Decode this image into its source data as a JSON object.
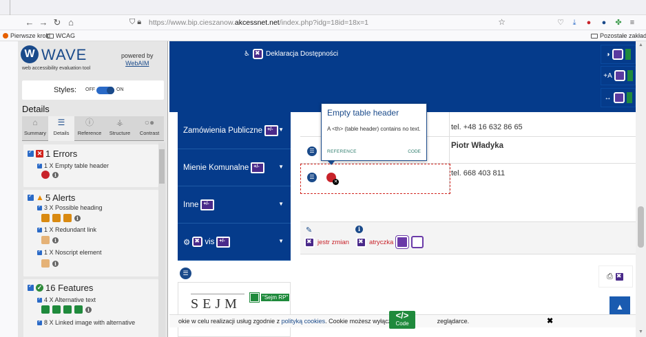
{
  "browser": {
    "url_prefix": "https://www.bip.cieszanow.",
    "url_domain": "akcessnet.net",
    "url_suffix": "/index.php?idg=18id=18x=1",
    "bookmarks": [
      "Pierwsze kroki",
      "WCAG"
    ],
    "other_bookmarks": "Pozostałe zakładki"
  },
  "wave": {
    "logo_letter": "W",
    "logo_text": "WAVE",
    "tagline": "web accessibility evaluation tool",
    "powered_by": "powered by",
    "webaim": "WebAIM",
    "styles_label": "Styles:",
    "off": "OFF",
    "on": "ON",
    "details_title": "Details",
    "tabs": [
      {
        "label": "Summary",
        "icon": "home-icon"
      },
      {
        "label": "Details",
        "icon": "list-icon"
      },
      {
        "label": "Reference",
        "icon": "info-icon"
      },
      {
        "label": "Structure",
        "icon": "structure-icon"
      },
      {
        "label": "Contrast",
        "icon": "contrast-icon"
      }
    ],
    "errors": {
      "title": "1 Errors",
      "items": [
        {
          "label": "1 X Empty table header"
        }
      ]
    },
    "alerts": {
      "title": "5 Alerts",
      "items": [
        {
          "label": "3 X Possible heading"
        },
        {
          "label": "1 X Redundant link"
        },
        {
          "label": "1 X Noscript element"
        }
      ]
    },
    "features": {
      "title": "16 Features",
      "items": [
        {
          "label": "4 X Alternative text"
        },
        {
          "label": "8 X Linked image with alternative"
        }
      ]
    }
  },
  "page": {
    "declaration": "Deklaracja Dostępności",
    "menu": [
      {
        "label": "Zamówienia Publiczne"
      },
      {
        "label": "Mienie Komunalne"
      },
      {
        "label": "Inne"
      },
      {
        "label": "vis"
      }
    ],
    "phone1": "tel. +48 16 632 86 65",
    "name": "Piotr Władyka",
    "phone2": "tel. 668 403 811",
    "link1": "jestr zmian",
    "link2": "atryczka",
    "sejm": "SEJM",
    "sejm_alt": "\"Sejm RP\"",
    "cookie_text_a": "okie w celu realizacji usług zgodnie z ",
    "cookie_link": "polityką cookies",
    "cookie_text_b": ". Cookie możesz wyłączy",
    "cookie_text_c": "zeglądarce.",
    "code_label": "Code",
    "code_symbol": "</>"
  },
  "tooltip": {
    "title": "Empty table header",
    "body": "A <th> (table header) contains no text.",
    "reference": "REFERENCE",
    "code": "CODE"
  },
  "colors": {
    "page_blue": "#053b8b",
    "wave_blue": "#1a4a8a",
    "error_red": "#c8232a",
    "feature_green": "#1f8a3c"
  }
}
